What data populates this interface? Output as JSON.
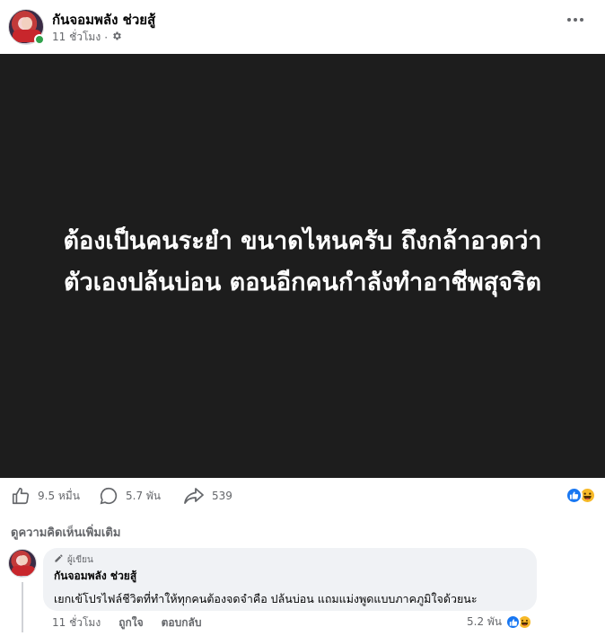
{
  "header": {
    "page_name": "กันจอมพลัง ช่วยสู้",
    "time": "11 ชั่วโมง",
    "separator": "·",
    "privacy_icon": "gear-icon",
    "more_icon": "more-horizontal-icon"
  },
  "post": {
    "line1": "ต้องเป็นคนระยำ ขนาดไหนครับ ถึงกล้าอวดว่า",
    "line2": "ตัวเองปล้นบ่อน ตอนอีกคนกำลังทำอาชีพสุจริต",
    "background": "#1d1d1d"
  },
  "stats": {
    "likes": "9.5 หมื่น",
    "comments": "5.7 พัน",
    "shares": "539",
    "like_icon": "thumbs-up-icon",
    "comment_icon": "comment-bubble-icon",
    "share_icon": "share-arrow-icon",
    "reactions": [
      "like-reaction-icon",
      "haha-reaction-icon"
    ]
  },
  "more_comments_label": "ดูความคิดเห็นเพิ่มเติม",
  "comment": {
    "author_badge": "ผู้เขียน",
    "author": "กันจอมพลัง ช่วยสู้",
    "text": "เยกเข้โปรไฟล์ชีวิตที่ทำให้ทุกคนต้องจดจำคือ ปล้นบ่อน แถมแม่งพูดแบบภาคภูมิใจด้วยนะ",
    "time": "11 ชั่วโมง",
    "like_label": "ถูกใจ",
    "reply_label": "ตอบกลับ",
    "reaction_count": "5.2 พัน"
  },
  "colors": {
    "accent": "#1877f2",
    "muted": "#65676b",
    "bubble": "#f0f2f5",
    "online": "#31a24c"
  }
}
